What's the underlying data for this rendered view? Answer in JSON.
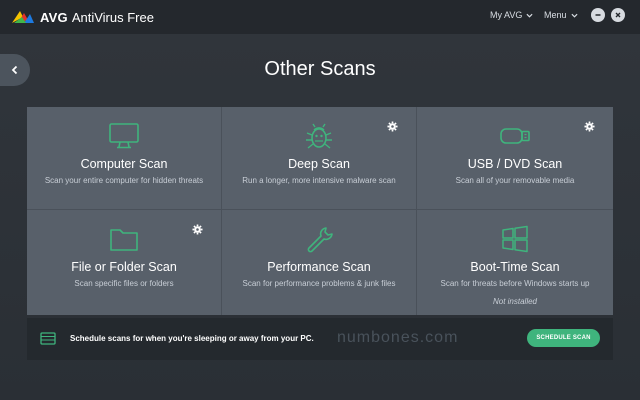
{
  "app": {
    "brand": "AVG",
    "product": "AntiVirus Free",
    "nav": {
      "my_avg": "My AVG",
      "menu": "Menu"
    }
  },
  "page": {
    "title": "Other Scans"
  },
  "tiles": [
    {
      "title": "Computer Scan",
      "desc": "Scan your entire computer for hidden threats",
      "icon": "monitor-icon",
      "has_settings": false
    },
    {
      "title": "Deep Scan",
      "desc": "Run a longer, more intensive malware scan",
      "icon": "bug-icon",
      "has_settings": true
    },
    {
      "title": "USB / DVD Scan",
      "desc": "Scan all of your removable media",
      "icon": "usb-drive-icon",
      "has_settings": true
    },
    {
      "title": "File or Folder Scan",
      "desc": "Scan specific files or folders",
      "icon": "folder-icon",
      "has_settings": true
    },
    {
      "title": "Performance Scan",
      "desc": "Scan for performance problems & junk files",
      "icon": "wrench-icon",
      "has_settings": false
    },
    {
      "title": "Boot-Time Scan",
      "desc": "Scan for threats before Windows starts up",
      "icon": "windows-logo-icon",
      "has_settings": false,
      "note": "Not installed"
    }
  ],
  "schedule": {
    "text": "Schedule scans for when you're sleeping or away from your PC.",
    "button": "SCHEDULE SCAN"
  },
  "watermark": "numbones.com",
  "colors": {
    "accent": "#3fb47d",
    "tile": "#58606a",
    "titlebar": "#24282d"
  }
}
